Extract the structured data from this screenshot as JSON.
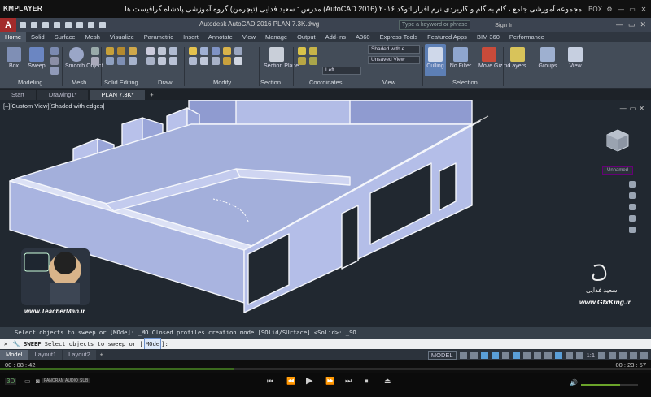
{
  "player": {
    "logo": "KMPLAYER",
    "title": "مجموعه آموزشی جامع ، گام به گام و کاربردی نرم افزار اتوکد ۲۰۱۶ (AutoCAD 2016) مدرس : سعید فدایی (تیچرمن) گروه آموزشی پادشاه گرافیست ها",
    "right_items": [
      "BOX",
      "⚙",
      "—",
      "▭",
      "✕"
    ],
    "time_elapsed": "00 : 08 : 42",
    "time_total": "00 : 23 : 57",
    "progress": 0.36,
    "volume": 0.68,
    "badge": "3D",
    "mini_labels": [
      "PANORAMA",
      "AUDIO",
      "SUB"
    ],
    "controls": [
      "⏮",
      "⏪",
      "▶",
      "⏩",
      "⏭",
      "⏹",
      "⏏"
    ]
  },
  "acad": {
    "app_letter": "A",
    "title": "Autodesk AutoCAD 2016    PLAN 7.3K.dwg",
    "search_placeholder": "Type a keyword or phrase",
    "sign_in": "Sign In",
    "win_controls": [
      "—",
      "▭",
      "✕"
    ]
  },
  "ribbon_tabs": [
    "Home",
    "Solid",
    "Surface",
    "Mesh",
    "Visualize",
    "Parametric",
    "Insert",
    "Annotate",
    "View",
    "Manage",
    "Output",
    "Add-ins",
    "A360",
    "Express Tools",
    "Featured Apps",
    "BIM 360",
    "Performance"
  ],
  "ribbon": {
    "buttons": {
      "box": "Box",
      "sweep": "Sweep",
      "smooth_object": "Smooth Object",
      "section_plane": "Section Plane",
      "culling": "Culling",
      "no_filter": "No Filter",
      "move_gizmo": "Move Gizmo",
      "layers": "Layers",
      "groups": "Groups",
      "view": "View"
    },
    "dropdowns": {
      "visual_style": "Shaded with e...",
      "view": "Unsaved View",
      "coord": "Left"
    },
    "panels": [
      "Modeling",
      "Mesh",
      "Solid Editing",
      "Draw",
      "Modify",
      "Section",
      "Coordinates",
      "View",
      "Selection"
    ]
  },
  "file_tabs": [
    "Start",
    "Drawing1*",
    "PLAN 7.3K*"
  ],
  "viewport": {
    "label": "[–][Custom View][Shaded with edges]",
    "controls": [
      "—",
      "▭",
      "✕"
    ],
    "unnamed": "Unnamed",
    "watermark_brand": "www.TeacherMan.ir",
    "watermark_name": "سعید فدایی",
    "watermark_url": "www.GfxKing.ir"
  },
  "command": {
    "history": "Select objects to sweep or [MOde]: _MO Closed profiles creation mode [SOlid/SUrface] <Solid>: _SO",
    "prompt_cmd": "SWEEP",
    "prompt_text": "Select objects to sweep or [",
    "prompt_option": "MOde",
    "prompt_end": "]:"
  },
  "layout_tabs": [
    "Model",
    "Layout1",
    "Layout2"
  ],
  "status": {
    "model": "MODEL",
    "scale": "1:1"
  },
  "colors": {
    "accent": "#3b6a1e",
    "wall_face": "#a9b4e0",
    "viewport_bg": "#212830"
  }
}
